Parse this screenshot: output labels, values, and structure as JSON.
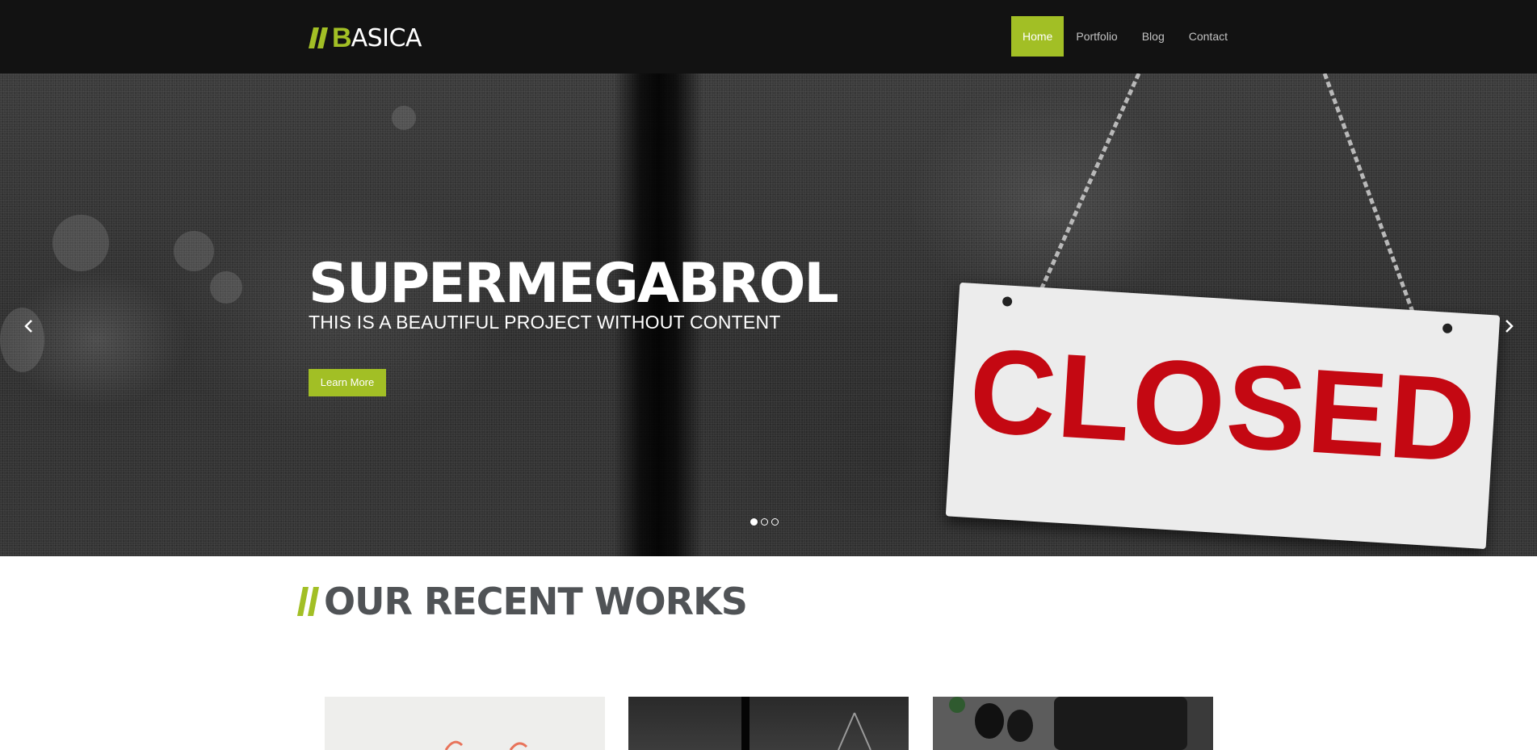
{
  "brand": {
    "logo_initial": "B",
    "logo_rest": "ASICA",
    "accent_color": "#a2bf25"
  },
  "nav": {
    "items": [
      {
        "label": "Home",
        "active": true
      },
      {
        "label": "Portfolio",
        "active": false
      },
      {
        "label": "Blog",
        "active": false
      },
      {
        "label": "Contact",
        "active": false
      }
    ]
  },
  "hero": {
    "title": "SUPERMEGABROL",
    "subtitle": "THIS IS A BEAUTIFUL PROJECT WITHOUT CONTENT",
    "button_label": "Learn More",
    "sign_text": "CLOSED",
    "prev_icon": "chevron-left-icon",
    "next_icon": "chevron-right-icon",
    "slides_total": 3,
    "slide_active": 1
  },
  "recent_works": {
    "title": "OUR RECENT WORKS"
  }
}
